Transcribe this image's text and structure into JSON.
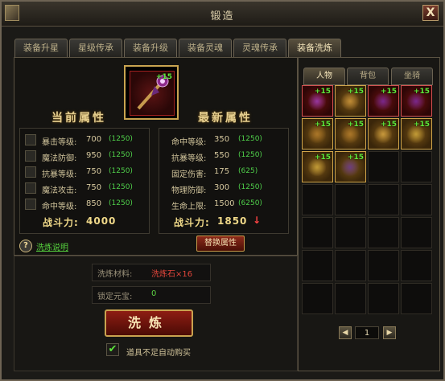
{
  "window": {
    "title": "锻造",
    "close_label": "X"
  },
  "tabs": [
    {
      "label": "装备升星"
    },
    {
      "label": "星级传承"
    },
    {
      "label": "装备升级"
    },
    {
      "label": "装备灵魂"
    },
    {
      "label": "灵魂传承"
    },
    {
      "label": "装备洗炼",
      "active": true
    }
  ],
  "item": {
    "plus": "+15",
    "icon": "staff-icon"
  },
  "current": {
    "title": "当前属性",
    "stats": [
      {
        "label": "暴击等级:",
        "value": "700",
        "max": "(1250)"
      },
      {
        "label": "魔法防御:",
        "value": "950",
        "max": "(1250)"
      },
      {
        "label": "抗暴等级:",
        "value": "750",
        "max": "(1250)"
      },
      {
        "label": "魔法攻击:",
        "value": "750",
        "max": "(1250)"
      },
      {
        "label": "命中等级:",
        "value": "850",
        "max": "(1250)"
      }
    ],
    "power_label": "战斗力:",
    "power_value": "4000"
  },
  "latest": {
    "title": "最新属性",
    "stats": [
      {
        "label": "命中等级:",
        "value": "350",
        "max": "(1250)"
      },
      {
        "label": "抗暴等级:",
        "value": "550",
        "max": "(1250)"
      },
      {
        "label": "固定伤害:",
        "value": "175",
        "max": "(625)"
      },
      {
        "label": "物理防御:",
        "value": "300",
        "max": "(1250)"
      },
      {
        "label": "生命上限:",
        "value": "1500",
        "max": "(6250)"
      }
    ],
    "power_label": "战斗力:",
    "power_value": "1850",
    "arrow": "↓"
  },
  "replace_button": "替换属性",
  "help": {
    "icon_text": "?",
    "link": "洗炼说明"
  },
  "material": {
    "label": "洗炼材料:",
    "value": "洗炼石×16"
  },
  "locked": {
    "label": "锁定元宝:",
    "value": "0"
  },
  "refine_button": "洗炼",
  "auto_buy": {
    "checked": true,
    "check_glyph": "✔",
    "label": "道具不足自动购买"
  },
  "inventory": {
    "tabs": [
      {
        "label": "人物",
        "active": true
      },
      {
        "label": "背包"
      },
      {
        "label": "坐骑"
      }
    ],
    "items": [
      {
        "color": "red",
        "plus": "+15",
        "icon": "staff-icon"
      },
      {
        "color": "gold",
        "plus": "+15",
        "icon": "boots-icon"
      },
      {
        "color": "red",
        "plus": "+15",
        "icon": "helmet-icon"
      },
      {
        "color": "red",
        "plus": "+15",
        "icon": "helmet-icon"
      },
      {
        "color": "gold",
        "plus": "+15",
        "icon": "armor-icon"
      },
      {
        "color": "gold",
        "plus": "+15",
        "icon": "armor-icon"
      },
      {
        "color": "gold",
        "plus": "+15",
        "icon": "ring-icon"
      },
      {
        "color": "gold",
        "plus": "+15",
        "icon": "leaf-icon"
      },
      {
        "color": "gold",
        "plus": "+15",
        "icon": "leaf-icon"
      },
      {
        "color": "gold",
        "plus": "+15",
        "icon": "wings-icon"
      }
    ],
    "page": "1",
    "prev_glyph": "◀",
    "next_glyph": "▶"
  },
  "colors": {
    "gold_border": "#d0a54a",
    "red_border": "#d35050",
    "green_text": "#4fcf4a",
    "power_text": "#f0d989"
  }
}
